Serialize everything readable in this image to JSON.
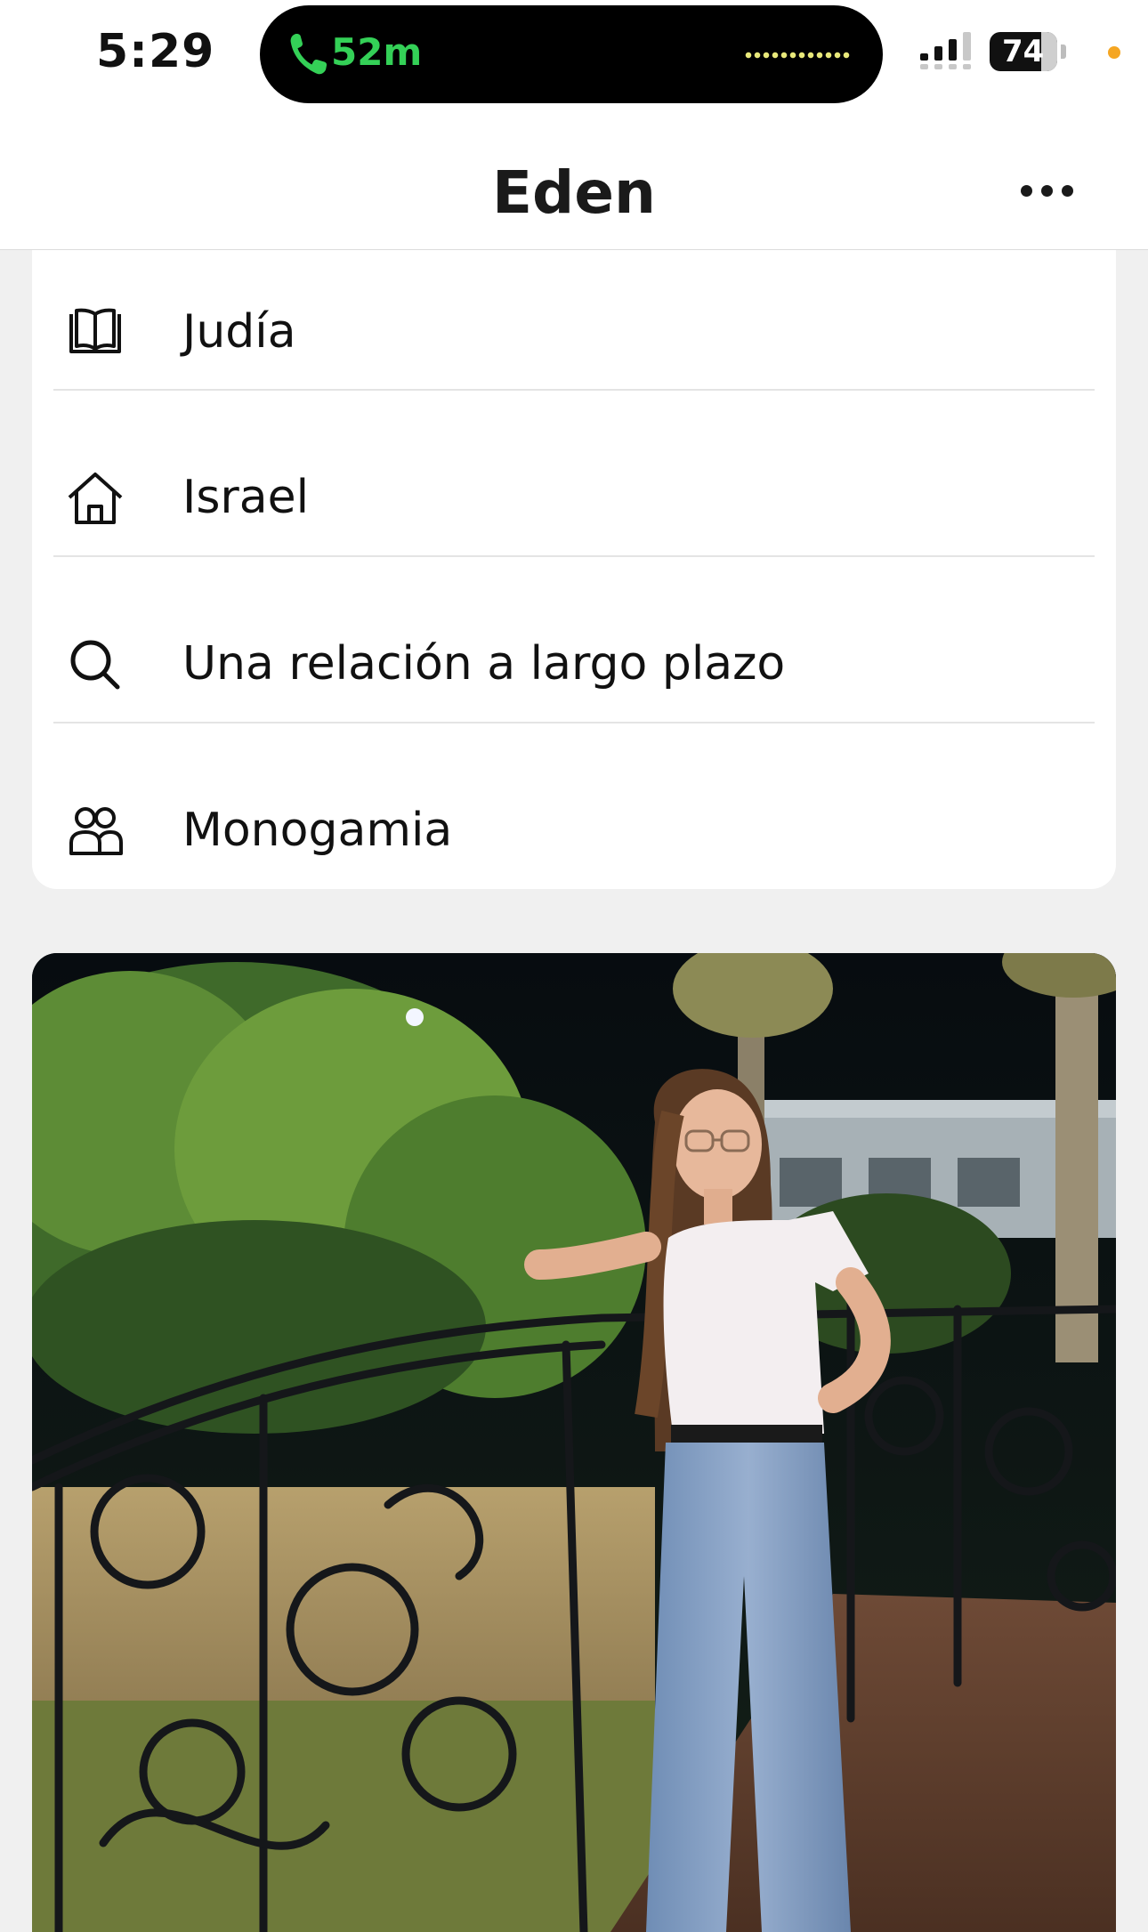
{
  "status_bar": {
    "time": "5:29",
    "call_duration": "52m",
    "battery_level": "74",
    "call_color": "#34d057"
  },
  "header": {
    "title": "Eden",
    "more_icon": "more-horizontal-icon"
  },
  "profile_details": [
    {
      "icon": "book-icon",
      "label": "Judía"
    },
    {
      "icon": "home-icon",
      "label": "Israel"
    },
    {
      "icon": "search-icon",
      "label": "Una relación a largo plazo"
    },
    {
      "icon": "people-icon",
      "label": "Monogamia"
    }
  ],
  "photo": {
    "subject": "profile-photo"
  }
}
